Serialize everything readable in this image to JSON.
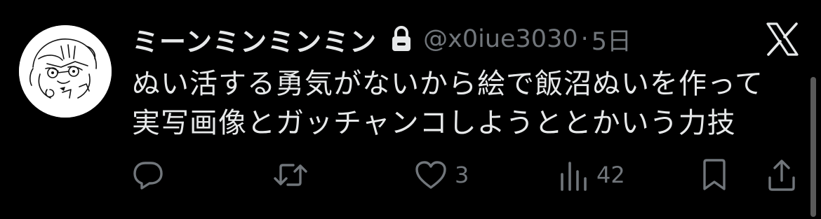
{
  "tweet": {
    "display_name": "ミーンミンミンミン",
    "handle": "@x0iue3030",
    "separator": "·",
    "time": "5日",
    "text_lines": [
      "ぬい活する勇気がないから絵で飯沼ぬいを作って",
      "実写画像とガッチャンコしようととかいう力技"
    ],
    "protected_icon": "lock-icon",
    "platform_icon": "x-logo-icon"
  },
  "actions": {
    "reply": {
      "icon": "reply-icon",
      "count": ""
    },
    "repost": {
      "icon": "repost-icon",
      "count": ""
    },
    "like": {
      "icon": "heart-icon",
      "count": "3"
    },
    "views": {
      "icon": "views-icon",
      "count": "42"
    },
    "bookmark": {
      "icon": "bookmark-icon",
      "count": ""
    },
    "share": {
      "icon": "share-icon",
      "count": ""
    }
  },
  "colors": {
    "background": "#000000",
    "primary_text": "#e7e9ea",
    "secondary_text": "#71767b"
  }
}
